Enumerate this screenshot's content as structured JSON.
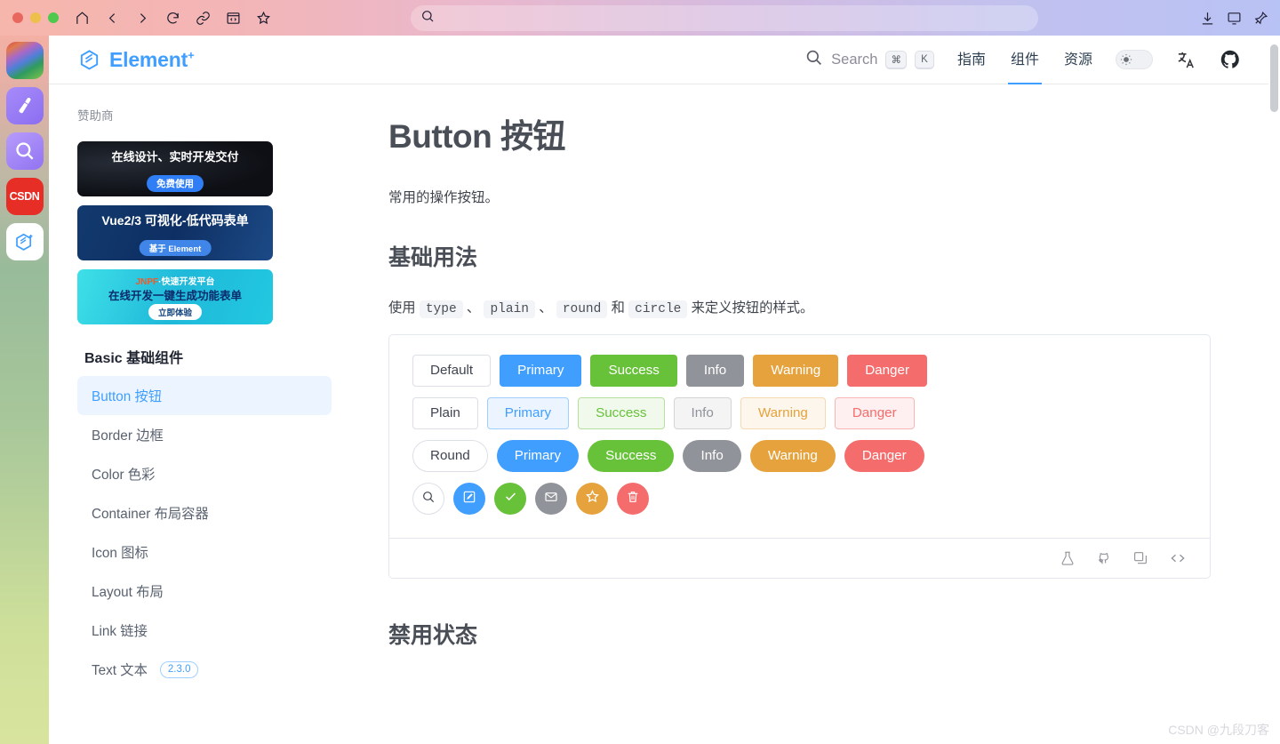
{
  "browser": {
    "traffic_lights": [
      "close",
      "minimize",
      "maximize"
    ],
    "nav_icons": [
      "home-icon",
      "back-icon",
      "forward-icon",
      "reload-icon",
      "link-icon",
      "reader-icon",
      "bookmark-icon"
    ],
    "url_value": "",
    "url_placeholder": "",
    "right_icons": [
      "download-icon",
      "cast-icon",
      "pin-icon"
    ]
  },
  "dock": {
    "items": [
      {
        "name": "wallpaper-app",
        "label": ""
      },
      {
        "name": "brush-app",
        "label": ""
      },
      {
        "name": "search-app",
        "label": ""
      },
      {
        "name": "csdn-app",
        "label": "CSDN"
      },
      {
        "name": "element-plus-app",
        "label": ""
      }
    ]
  },
  "header": {
    "brand": "Element",
    "brand_superscript": "+",
    "search": {
      "label": "Search",
      "key1": "⌘",
      "key2": "K"
    },
    "nav": [
      {
        "label": "指南",
        "active": false
      },
      {
        "label": "组件",
        "active": true
      },
      {
        "label": "资源",
        "active": false
      }
    ],
    "theme_toggle": "sun-icon",
    "language_icon": "translate-icon",
    "github_icon": "github-icon",
    "accent_color": "#409eff"
  },
  "sidebar": {
    "sponsor_label": "赞助商",
    "ads": [
      {
        "title": "在线设计、实时开发交付",
        "cta": "免费使用"
      },
      {
        "title": "Vue2/3 可视化-低代码表单",
        "cta": "基于 Element"
      },
      {
        "brand": "JNPF",
        "title": "·快速开发平台",
        "title2": "在线开发一键生成功能表单",
        "cta": "立即体验"
      }
    ],
    "group_title": "Basic 基础组件",
    "items": [
      {
        "label": "Button 按钮",
        "active": true,
        "version": ""
      },
      {
        "label": "Border 边框",
        "active": false,
        "version": ""
      },
      {
        "label": "Color 色彩",
        "active": false,
        "version": ""
      },
      {
        "label": "Container 布局容器",
        "active": false,
        "version": ""
      },
      {
        "label": "Icon 图标",
        "active": false,
        "version": ""
      },
      {
        "label": "Layout 布局",
        "active": false,
        "version": ""
      },
      {
        "label": "Link 链接",
        "active": false,
        "version": ""
      },
      {
        "label": "Text 文本",
        "active": false,
        "version": "2.3.0"
      }
    ]
  },
  "main": {
    "title": "Button 按钮",
    "description": "常用的操作按钮。",
    "section1_heading": "基础用法",
    "usage_prefix": "使用",
    "code_type": "type",
    "sep1": "、",
    "code_plain": "plain",
    "sep2": "、",
    "code_round": "round",
    "conj": "和",
    "code_circle": "circle",
    "usage_suffix": "来定义按钮的样式。",
    "demo_rows": {
      "basic": [
        {
          "label": "Default",
          "variant": "default"
        },
        {
          "label": "Primary",
          "variant": "primary"
        },
        {
          "label": "Success",
          "variant": "success"
        },
        {
          "label": "Info",
          "variant": "info"
        },
        {
          "label": "Warning",
          "variant": "warning"
        },
        {
          "label": "Danger",
          "variant": "danger"
        }
      ],
      "plain": [
        {
          "label": "Plain",
          "variant": "plain-default"
        },
        {
          "label": "Primary",
          "variant": "plain-primary"
        },
        {
          "label": "Success",
          "variant": "plain-success"
        },
        {
          "label": "Info",
          "variant": "plain-info"
        },
        {
          "label": "Warning",
          "variant": "plain-warning"
        },
        {
          "label": "Danger",
          "variant": "plain-danger"
        }
      ],
      "round": [
        {
          "label": "Round",
          "variant": "default"
        },
        {
          "label": "Primary",
          "variant": "primary"
        },
        {
          "label": "Success",
          "variant": "success"
        },
        {
          "label": "Info",
          "variant": "info"
        },
        {
          "label": "Warning",
          "variant": "warning"
        },
        {
          "label": "Danger",
          "variant": "danger"
        }
      ],
      "circle": [
        {
          "icon": "search-icon",
          "variant": "default"
        },
        {
          "icon": "edit-icon",
          "variant": "primary"
        },
        {
          "icon": "check-icon",
          "variant": "success"
        },
        {
          "icon": "message-icon",
          "variant": "info"
        },
        {
          "icon": "star-icon",
          "variant": "warning"
        },
        {
          "icon": "delete-icon",
          "variant": "danger"
        }
      ]
    },
    "demo_actions": [
      "playground-icon",
      "github-icon",
      "copy-icon",
      "code-icon"
    ],
    "section2_heading": "禁用状态"
  },
  "watermark": "CSDN @九段刀客",
  "colors": {
    "primary": "#409eff",
    "success": "#67c23a",
    "info": "#909399",
    "warning": "#e6a23c",
    "danger": "#f56c6c"
  }
}
